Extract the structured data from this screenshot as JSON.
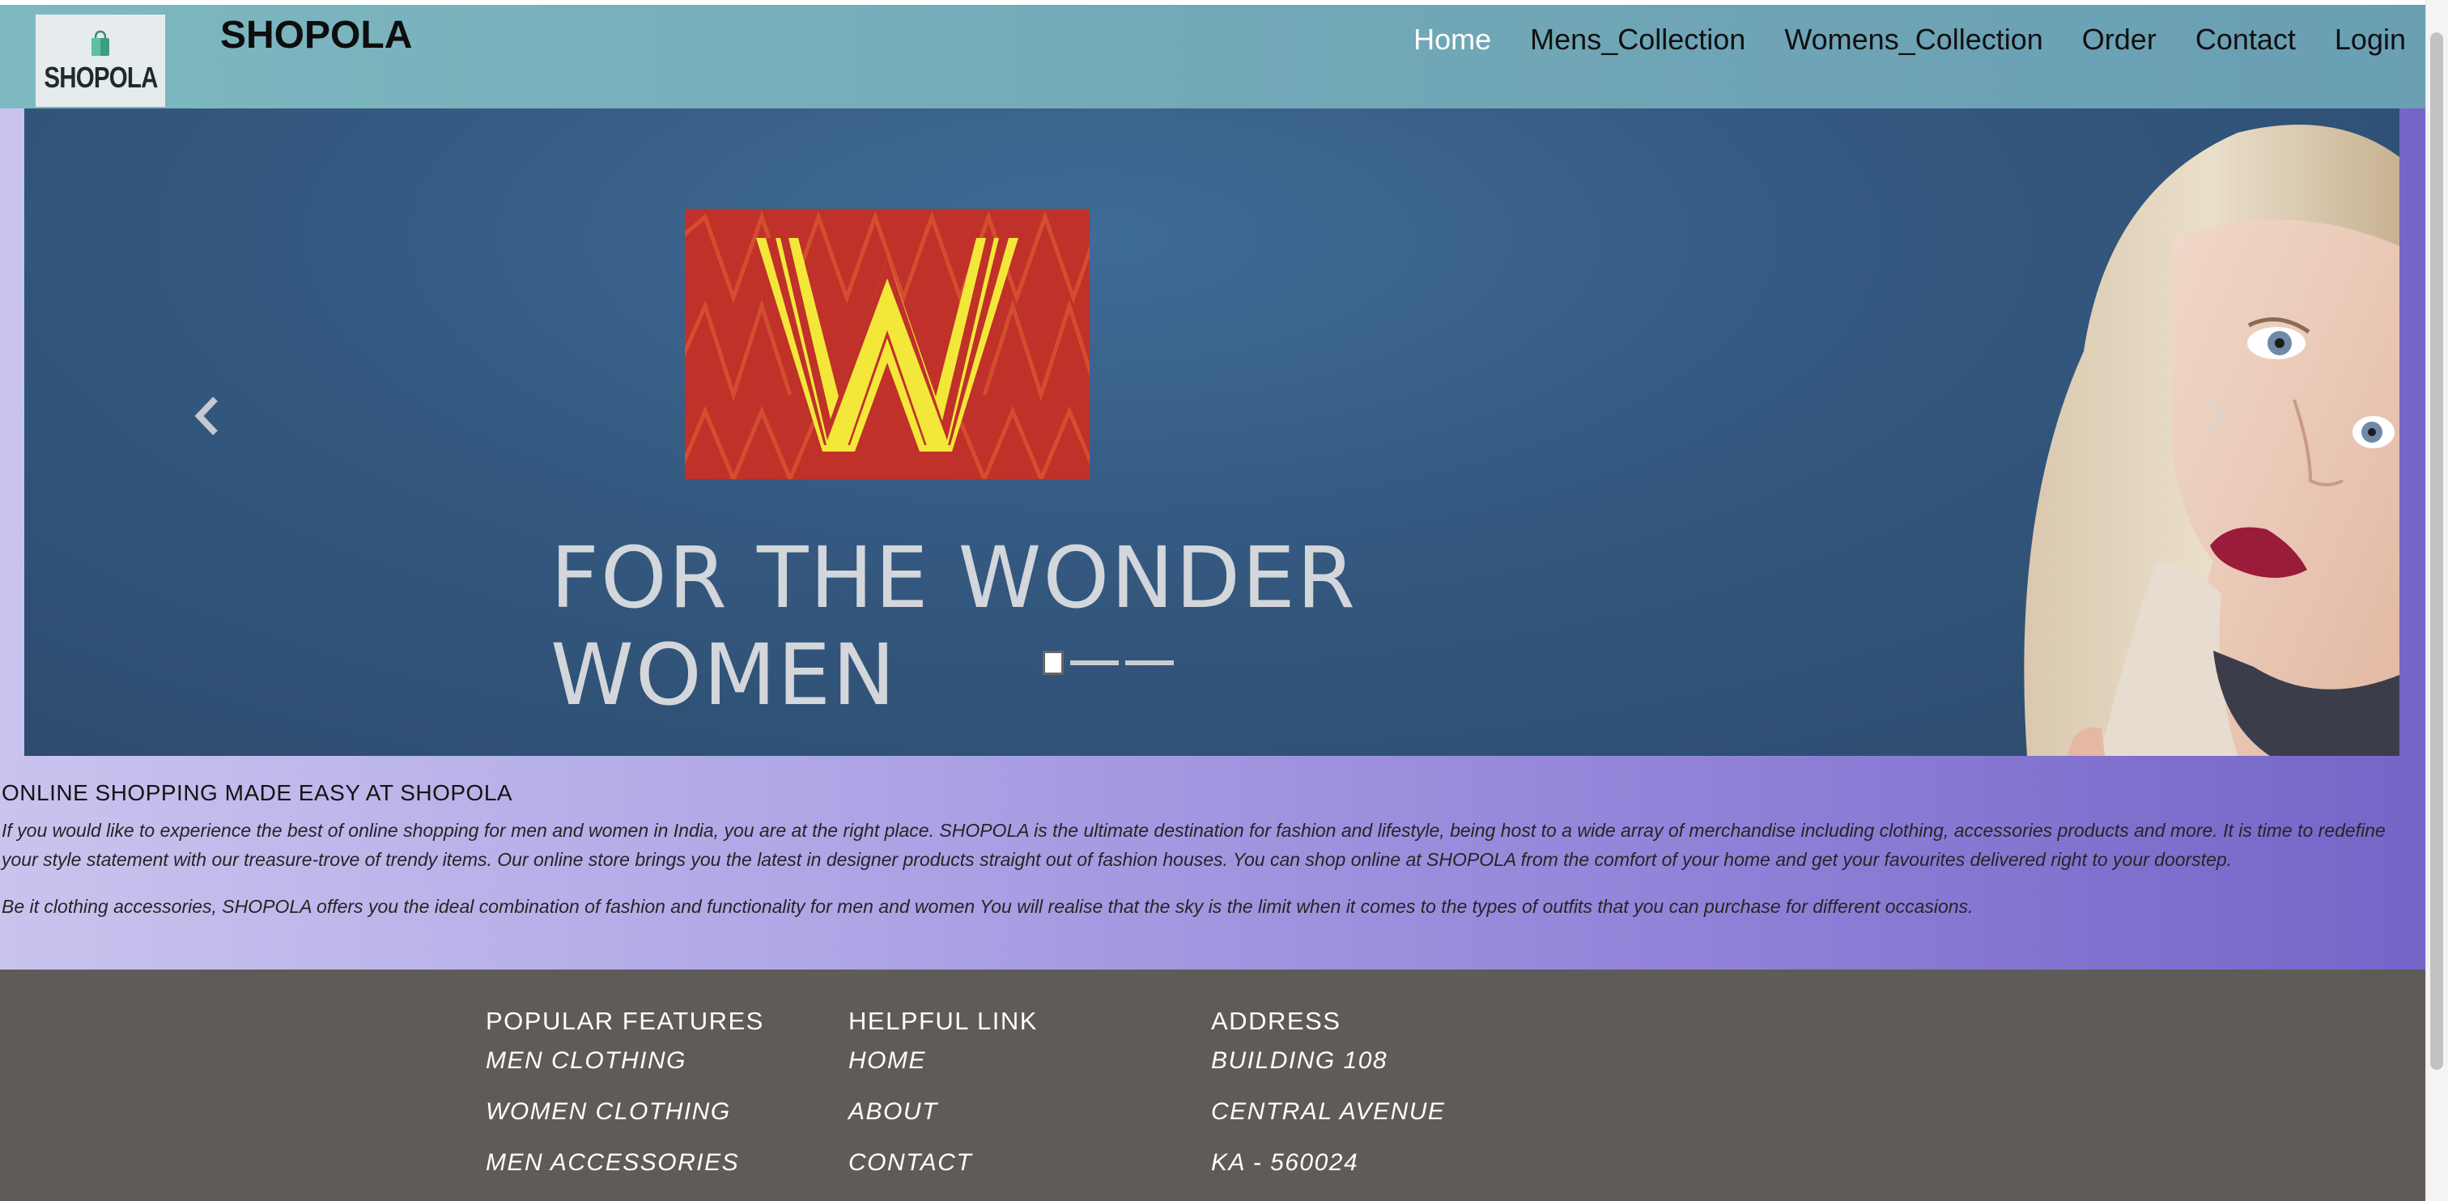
{
  "brand": {
    "logo_text": "SHOPOLA",
    "title": "SHOPOLA"
  },
  "nav": [
    {
      "label": "Home",
      "active": true
    },
    {
      "label": "Mens_Collection"
    },
    {
      "label": "Womens_Collection"
    },
    {
      "label": "Order"
    },
    {
      "label": "Contact"
    },
    {
      "label": "Login"
    }
  ],
  "carousel": {
    "headline_line1": "FOR THE WONDER",
    "headline_line2": "WOMEN",
    "indicator_count": 3,
    "active_index": 0
  },
  "about": {
    "title": "ONLINE SHOPPING MADE EASY AT SHOPOLA",
    "paragraph1": "If you would like to experience the best of online shopping for men and women in India, you are at the right place. SHOPOLA is the ultimate destination for fashion and lifestyle, being host to a wide array of merchandise including clothing, accessories products and more. It is time to redefine your style statement with our treasure-trove of trendy items. Our online store brings you the latest in designer products straight out of fashion houses. You can shop online at SHOPOLA from the comfort of your home and get your favourites delivered right to your doorstep.",
    "paragraph2": "Be it clothing accessories, SHOPOLA offers you the ideal combination of fashion and functionality for men and women You will realise that the sky is the limit when it comes to the types of outfits that you can purchase for different occasions."
  },
  "footer": {
    "popular": {
      "heading": "POPULAR FEATURES",
      "items": [
        "MEN CLOTHING",
        "WOMEN CLOTHING",
        "MEN ACCESSORIES"
      ]
    },
    "helpful": {
      "heading": "HELPFUL LINK",
      "items": [
        "HOME",
        "ABOUT",
        "CONTACT"
      ]
    },
    "address": {
      "heading": "ADDRESS",
      "items": [
        "BUILDING 108",
        "CENTRAL AVENUE",
        "KA - 560024"
      ]
    }
  },
  "colors": {
    "navbar": "#72a9b7",
    "banner_red": "#c0312a",
    "banner_w": "#f3e83a",
    "footer": "#5f5b59"
  }
}
